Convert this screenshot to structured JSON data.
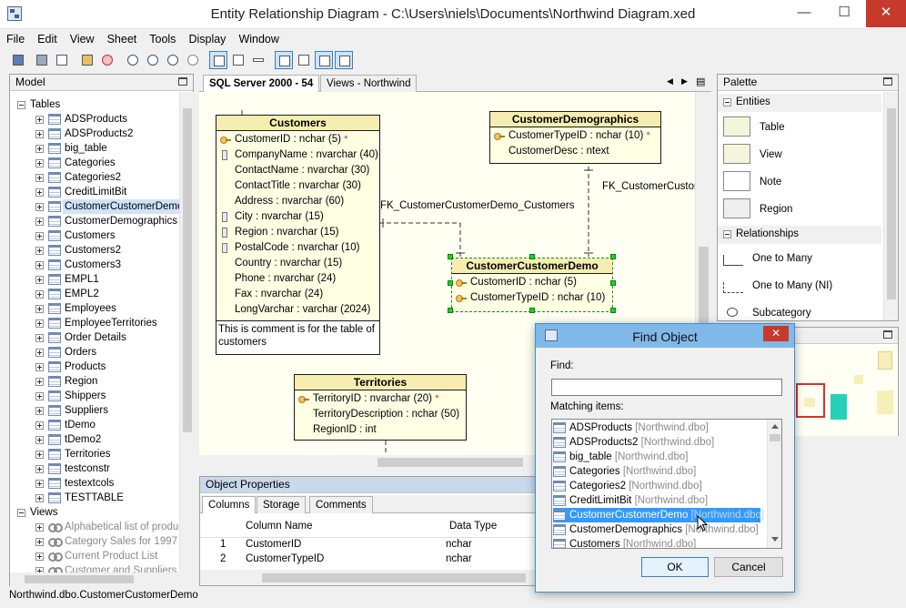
{
  "window": {
    "title": "Entity Relationship Diagram - C:\\Users\\niels\\Documents\\Northwind Diagram.xed",
    "minimize": "—",
    "maximize": "☐",
    "close": "✕"
  },
  "menu": [
    "File",
    "Edit",
    "View",
    "Sheet",
    "Tools",
    "Display",
    "Window"
  ],
  "model_panel": {
    "title": "Model",
    "tables_label": "Tables",
    "tables": [
      "ADSProducts",
      "ADSProducts2",
      "big_table",
      "Categories",
      "Categories2",
      "CreditLimitBit",
      "CustomerCustomerDemo",
      "CustomerDemographics",
      "Customers",
      "Customers2",
      "Customers3",
      "EMPL1",
      "EMPL2",
      "Employees",
      "EmployeeTerritories",
      "Order Details",
      "Orders",
      "Products",
      "Region",
      "Shippers",
      "Suppliers",
      "tDemo",
      "tDemo2",
      "Territories",
      "testconstr",
      "testextcols",
      "TESTTABLE"
    ],
    "selected_table": "CustomerCustomerDemo",
    "views_label": "Views",
    "views": [
      "Alphabetical list of produc",
      "Category Sales for 1997",
      "Current Product List",
      "Customer and Suppliers b"
    ]
  },
  "tabs": {
    "sql": "SQL Server 2000 - 54",
    "views": "Views - Northwind",
    "prev": "◀",
    "next": "▶",
    "list": "▤"
  },
  "diagram": {
    "customers": {
      "title": "Customers",
      "columns": [
        "CustomerID : nchar (5)",
        "CompanyName : nvarchar (40)",
        "ContactName : nvarchar (30)",
        "ContactTitle : nvarchar (30)",
        "Address : nvarchar (60)",
        "City : nvarchar (15)",
        "Region : nvarchar (15)",
        "PostalCode : nvarchar (10)",
        "Country : nvarchar (15)",
        "Phone : nvarchar (24)",
        "Fax : nvarchar (24)",
        "LongVarchar : varchar (2024)"
      ],
      "comment": "This is comment is for the table of customers"
    },
    "demographics": {
      "title": "CustomerDemographics",
      "columns": [
        "CustomerTypeID : nchar (10)",
        "CustomerDesc : ntext"
      ]
    },
    "ccd": {
      "title": "CustomerCustomerDemo",
      "columns": [
        "CustomerID : nchar (5)",
        "CustomerTypeID : nchar (10)"
      ]
    },
    "territories": {
      "title": "Territories",
      "columns": [
        "TerritoryID : nvarchar (20)",
        "TerritoryDescription : nchar (50)",
        "RegionID : int"
      ]
    },
    "rel1": "FK_CustomerCustomerDemo_Customers",
    "rel2": "FK_CustomerCustom",
    "pk_marker": "*"
  },
  "properties": {
    "title": "Object Properties",
    "tabs": [
      "Columns",
      "Storage",
      "Comments"
    ],
    "headers": [
      "Column Name",
      "Data Type"
    ],
    "rows": [
      {
        "n": "1",
        "name": "CustomerID",
        "type": "nchar"
      },
      {
        "n": "2",
        "name": "CustomerTypeID",
        "type": "nchar"
      }
    ]
  },
  "palette": {
    "title": "Palette",
    "entities_label": "Entities",
    "entities": [
      "Table",
      "View",
      "Note",
      "Region"
    ],
    "relationships_label": "Relationships",
    "relationships": [
      "One to Many",
      "One to Many (NI)",
      "Subcategory"
    ]
  },
  "find": {
    "title": "Find Object",
    "find_label": "Find:",
    "find_value": "",
    "matching_label": "Matching items:",
    "items": [
      {
        "name": "ADSProducts",
        "ns": "[Northwind.dbo]"
      },
      {
        "name": "ADSProducts2",
        "ns": "[Northwind.dbo]"
      },
      {
        "name": "big_table",
        "ns": "[Northwind.dbo]"
      },
      {
        "name": "Categories",
        "ns": "[Northwind.dbo]"
      },
      {
        "name": "Categories2",
        "ns": "[Northwind.dbo]"
      },
      {
        "name": "CreditLimitBit",
        "ns": "[Northwind.dbo]"
      },
      {
        "name": "CustomerCustomerDemo",
        "ns": "[Northwind.dbo]"
      },
      {
        "name": "CustomerDemographics",
        "ns": "[Northwind.dbo]"
      },
      {
        "name": "Customers",
        "ns": "[Northwind.dbo]"
      }
    ],
    "selected_index": 6,
    "ok": "OK",
    "cancel": "Cancel",
    "close": "✕"
  },
  "status": "Northwind.dbo.CustomerCustomerDemo"
}
